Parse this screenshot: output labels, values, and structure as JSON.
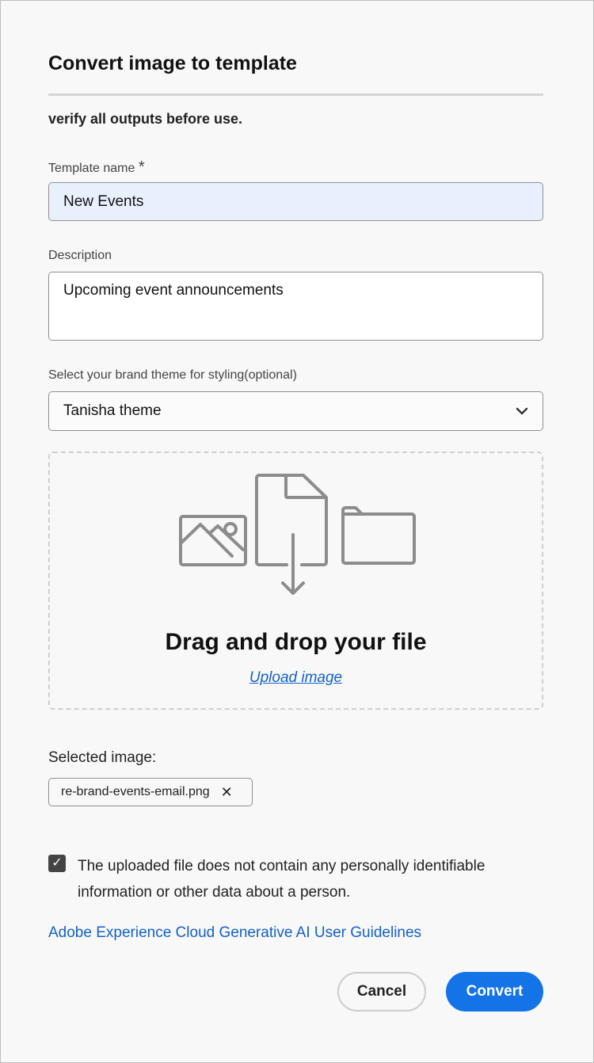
{
  "dialog": {
    "title": "Convert image to template",
    "warning": "verify all outputs before use.",
    "template_name": {
      "label": "Template name",
      "required": "*",
      "value": "New Events"
    },
    "description": {
      "label": "Description",
      "value": "Upcoming event announcements"
    },
    "brand_theme": {
      "label": "Select your brand theme for styling(optional)",
      "value": "Tanisha theme"
    },
    "dropzone": {
      "title": "Drag and drop your file",
      "upload_link": "Upload image"
    },
    "selected": {
      "label": "Selected image:",
      "file": "re-brand-events-email.png"
    },
    "consent": {
      "checked": true,
      "text": "The uploaded file does not contain any personally identifiable information or other data about a person."
    },
    "guidelines_link": "Adobe Experience Cloud Generative AI User Guidelines",
    "buttons": {
      "cancel": "Cancel",
      "convert": "Convert"
    }
  },
  "colors": {
    "accent": "#1473e6",
    "link": "#1360c6"
  }
}
